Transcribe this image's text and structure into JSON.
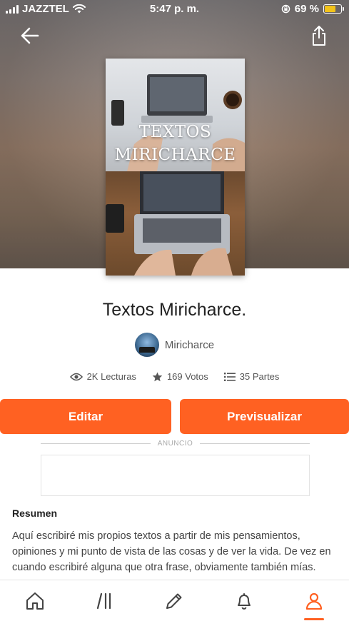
{
  "status_bar": {
    "carrier": "JAZZTEL",
    "time": "5:47 p. m.",
    "battery_percent": "69 %",
    "battery_level": 0.69
  },
  "cover": {
    "title_line1": "TEXTOS",
    "title_line2": "MIRICHARCE"
  },
  "book": {
    "title": "Textos Miricharce.",
    "author": "Miricharce"
  },
  "stats": {
    "reads": "2K Lecturas",
    "votes": "169 Votos",
    "parts": "35 Partes"
  },
  "actions": {
    "edit_label": "Editar",
    "preview_label": "Previsualizar"
  },
  "ad": {
    "label": "ANUNCIO"
  },
  "summary": {
    "heading": "Resumen",
    "text": "Aquí escribiré mis propios textos a partir de mis pensamientos, opiniones y mi punto de vista de las cosas y de ver la vida. De vez en cuando escribiré alguna que otra frase, obviamente también mías."
  },
  "tabs": [
    {
      "icon": "home-icon"
    },
    {
      "icon": "library-icon"
    },
    {
      "icon": "pencil-icon"
    },
    {
      "icon": "bell-icon"
    },
    {
      "icon": "profile-icon",
      "active": true
    }
  ],
  "colors": {
    "accent": "#ff6122",
    "battery": "#f2c31a"
  }
}
